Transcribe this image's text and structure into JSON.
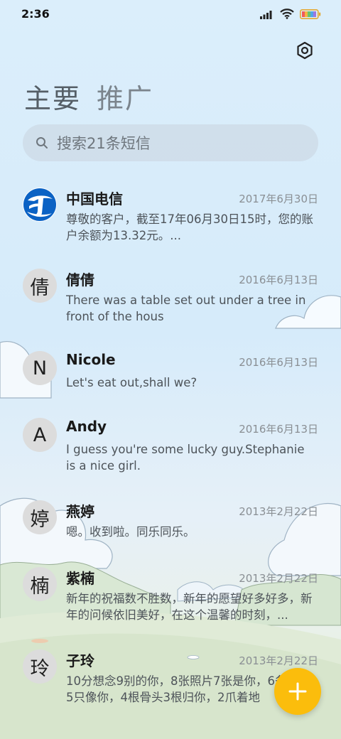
{
  "status_bar": {
    "time": "2:36"
  },
  "tabs": [
    {
      "label": "主要"
    },
    {
      "label": "推广"
    }
  ],
  "search": {
    "placeholder": "搜索21条短信"
  },
  "messages": [
    {
      "sender": "中国电信",
      "avatar": "china-telecom-logo",
      "date": "2017年6月30日",
      "preview": "尊敬的客户，截至17年06月30日15时，您的账户余额为13.32元。..."
    },
    {
      "sender": "倩倩",
      "avatar": "倩",
      "date": "2016年6月13日",
      "preview": "There was a table set out under a tree in front of the hous"
    },
    {
      "sender": "Nicole",
      "avatar": "N",
      "date": "2016年6月13日",
      "preview": "Let's eat out,shall we?"
    },
    {
      "sender": "Andy",
      "avatar": "A",
      "date": "2016年6月13日",
      "preview": "I guess you're some lucky guy.Stephanie is a nice girl."
    },
    {
      "sender": "燕婷",
      "avatar": "婷",
      "date": "2013年2月22日",
      "preview": "嗯。收到啦。同乐同乐。"
    },
    {
      "sender": "紫楠",
      "avatar": "楠",
      "date": "2013年2月22日",
      "preview": "新年的祝福数不胜数，新年的愿望好多好多，新年的问候依旧美好，在这个温馨的时刻，..."
    },
    {
      "sender": "子玲",
      "avatar": "玲",
      "date": "2013年2月22日",
      "preview": "10分想念9别的你，8张照片7张是你，6条小狗5只像你，4根骨头3根归你，2爪着地"
    }
  ],
  "icons": {
    "settings": "gear-icon",
    "search": "search-icon",
    "compose": "plus-icon",
    "signal": "signal-icon",
    "wifi": "wifi-icon",
    "battery": "battery-icon"
  },
  "colors": {
    "fab": "#fbbd0c",
    "background": "#dbeefb",
    "telecom_blue": "#0b62c4"
  }
}
